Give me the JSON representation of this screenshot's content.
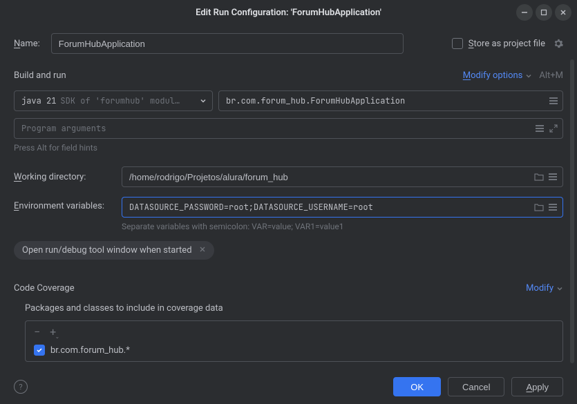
{
  "window": {
    "title": "Edit Run Configuration: 'ForumHubApplication'"
  },
  "name": {
    "label": "Name:",
    "value": "ForumHubApplication"
  },
  "store_as_project": {
    "label": "Store as project file",
    "checked": false
  },
  "build_run": {
    "title": "Build and run",
    "modify_label": "Modify options",
    "shortcut": "Alt+M",
    "jdk_version": "java 21",
    "jdk_desc": "SDK of 'forumhub' modul…",
    "main_class": "br.com.forum_hub.ForumHubApplication",
    "args_placeholder": "Program arguments",
    "hint": "Press Alt for field hints"
  },
  "working_dir": {
    "label": "Working directory:",
    "value": "/home/rodrigo/Projetos/alura/forum_hub"
  },
  "env_vars": {
    "label": "Environment variables:",
    "value": "DATASOURCE_PASSWORD=root;DATASOURCE_USERNAME=root",
    "helper": "Separate variables with semicolon: VAR=value; VAR1=value1"
  },
  "chip": {
    "text": "Open run/debug tool window when started"
  },
  "coverage": {
    "title": "Code Coverage",
    "modify_label": "Modify",
    "subtitle": "Packages and classes to include in coverage data",
    "item": "br.com.forum_hub.*"
  },
  "footer": {
    "ok": "OK",
    "cancel": "Cancel",
    "apply": "Apply"
  }
}
